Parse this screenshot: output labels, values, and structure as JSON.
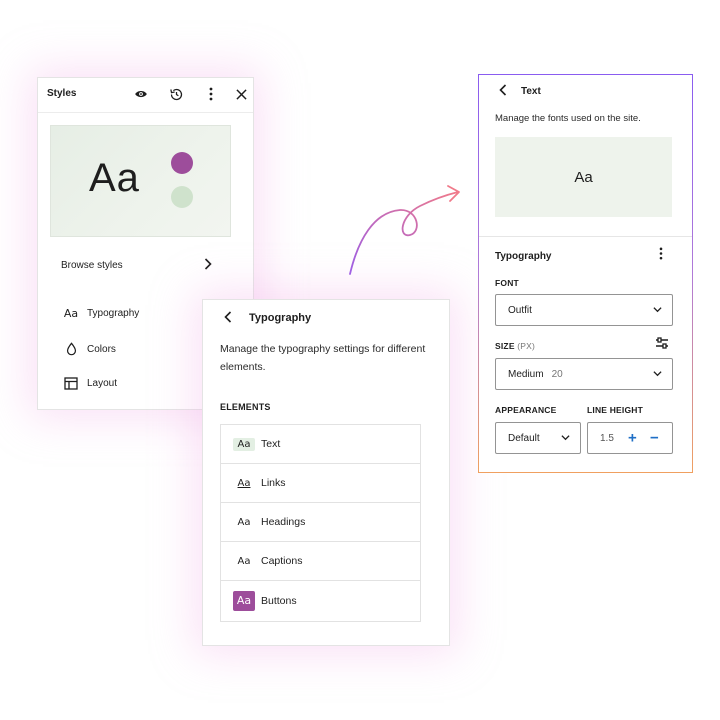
{
  "styles_panel": {
    "title": "Styles",
    "icons": [
      "eye-icon",
      "history-icon",
      "more-vertical-icon",
      "close-icon"
    ],
    "preview": {
      "sample_text": "Aa",
      "accent_color": "#9d4d9b",
      "secondary_color": "#cfe2cc"
    },
    "browse_label": "Browse styles",
    "items": [
      {
        "icon_text": "Aa",
        "label": "Typography"
      },
      {
        "icon": "drop-icon",
        "label": "Colors"
      },
      {
        "icon": "layout-icon",
        "label": "Layout"
      }
    ]
  },
  "typography_panel": {
    "title": "Typography",
    "description": "Manage the typography settings for different elements.",
    "elements_heading": "ELEMENTS",
    "elements": [
      {
        "icon_text": "Aa",
        "label": "Text"
      },
      {
        "icon_text": "Aa",
        "label": "Links"
      },
      {
        "icon_text": "Aa",
        "label": "Headings"
      },
      {
        "icon_text": "Aa",
        "label": "Captions"
      },
      {
        "icon_text": "Aa",
        "label": "Buttons"
      }
    ]
  },
  "text_panel": {
    "title": "Text",
    "description": "Manage the fonts used on the site.",
    "preview_text": "Aa",
    "section_title": "Typography",
    "font_label": "FONT",
    "font_value": "Outfit",
    "size_label": "SIZE",
    "size_unit": "(PX)",
    "size_value": "Medium",
    "size_number": "20",
    "appearance_label": "APPEARANCE",
    "appearance_value": "Default",
    "line_height_label": "LINE HEIGHT",
    "line_height_value": "1.5"
  },
  "colors": {
    "accent": "#9d4d9b",
    "link_blue": "#1f6fc6",
    "arrow_start": "#9b5de5",
    "arrow_end": "#e8708a"
  }
}
